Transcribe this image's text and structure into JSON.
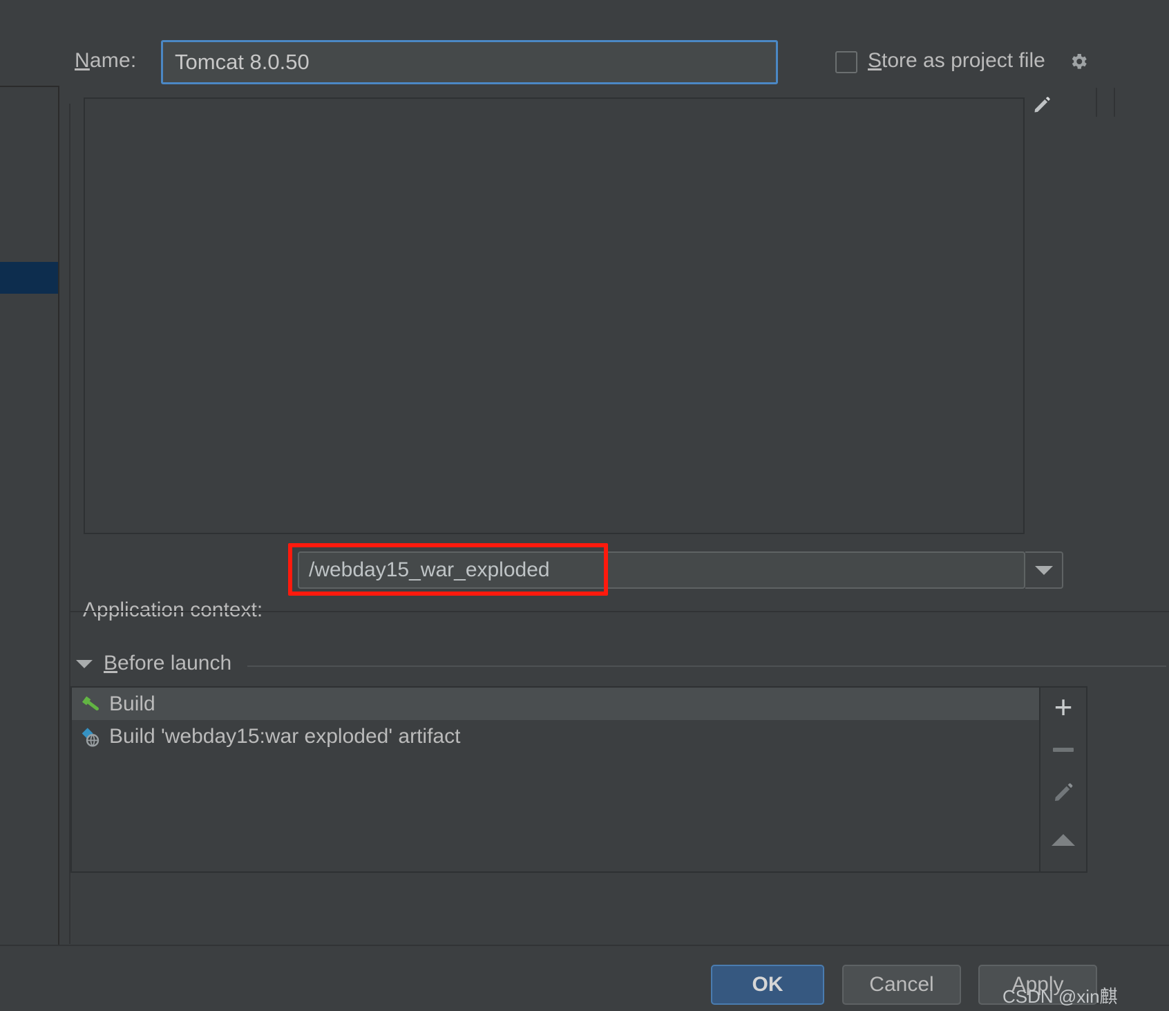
{
  "window": {
    "background_color": "#3c3f41",
    "accent_color": "#4b88c5",
    "highlight_color": "#ff1a0d"
  },
  "name_row": {
    "label_mnemonic": "N",
    "label_rest": "ame:",
    "value": "Tomcat 8.0.50",
    "placeholder": "Unnamed"
  },
  "store_as_project_file": {
    "checked": false,
    "label_mnemonic": "S",
    "label_rest": "tore as project file",
    "gear_icon": "gear-icon"
  },
  "panel": {
    "edit_icon": "pencil-icon"
  },
  "application_context": {
    "label": "Application context:",
    "value": "/webday15_war_exploded",
    "placeholder": "/context",
    "dropdown_icon": "chevron-down-icon",
    "highlighted": true
  },
  "before_launch": {
    "title_mnemonic": "B",
    "title_rest": "efore launch",
    "collapse_icon": "triangle-down-icon",
    "items": [
      {
        "icon": "hammer-icon",
        "label": "Build",
        "selected": true
      },
      {
        "icon": "artifact-icon",
        "label": "Build 'webday15:war exploded' artifact",
        "selected": false
      }
    ],
    "toolbar": [
      {
        "icon": "plus-icon",
        "name": "add-task-button",
        "enabled": true
      },
      {
        "icon": "minus-icon",
        "name": "remove-task-button",
        "enabled": false
      },
      {
        "icon": "pencil-icon",
        "name": "edit-task-button",
        "enabled": true
      },
      {
        "icon": "arrow-up-icon",
        "name": "move-up-button",
        "enabled": true
      }
    ]
  },
  "buttons": {
    "ok": "OK",
    "cancel": "Cancel",
    "apply": "Apply"
  },
  "watermark": "CSDN @xin麒"
}
